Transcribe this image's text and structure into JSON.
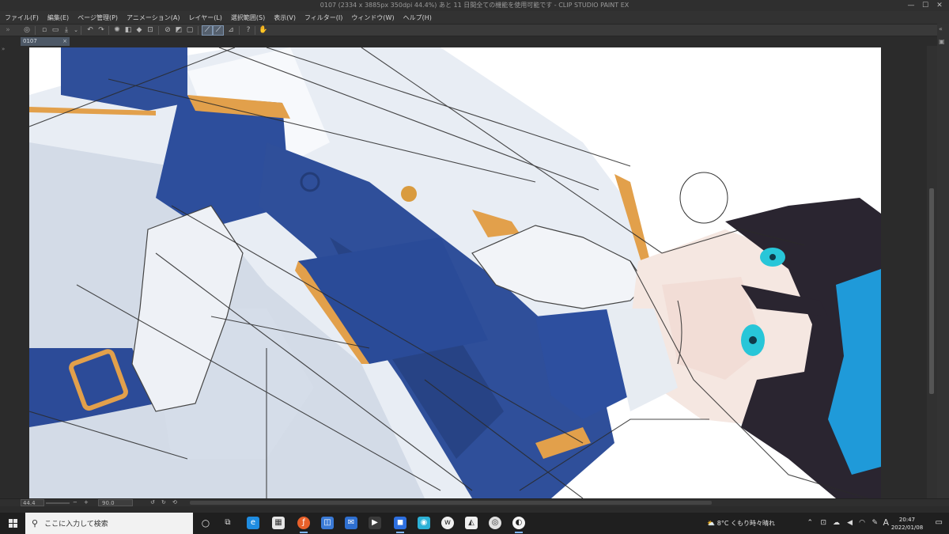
{
  "window": {
    "title": "0107 (2334 x 3885px 350dpi 44.4%)  あと 11 日間全ての機能を使用可能です - CLIP STUDIO PAINT EX",
    "minimize": "—",
    "maximize": "☐",
    "close": "✕"
  },
  "menu": [
    "ファイル(F)",
    "編集(E)",
    "ページ管理(P)",
    "アニメーション(A)",
    "レイヤー(L)",
    "選択範囲(S)",
    "表示(V)",
    "フィルター(I)",
    "ウィンドウ(W)",
    "ヘルプ(H)"
  ],
  "toolbar": {
    "icons": [
      "clip-studio-icon",
      "new-icon",
      "open-icon",
      "save-icon",
      "undo-icon",
      "redo-icon",
      "clear-icon",
      "fill-icon",
      "transform-icon",
      "deselect-icon",
      "invert-selection-icon",
      "selection-border-icon",
      "snap-ruler-icon",
      "snap-grid-icon",
      "ruler-icon",
      "help-icon",
      "hand-icon"
    ]
  },
  "document_tab": {
    "label": "0107",
    "close": "×"
  },
  "statusbar": {
    "zoom": "44.4",
    "zoom_minus": "−",
    "zoom_plus": "+",
    "rotation": "90.0"
  },
  "taskbar": {
    "search_placeholder": "ここに入力して検索",
    "weather": "8°C  くもり時々晴れ",
    "ime": "A",
    "time": "20:47",
    "date": "2022/01/08"
  },
  "colors": {
    "uniform_blue": "#2f4f9a",
    "uniform_blue_dark": "#233c78",
    "gold": "#e2a04b",
    "hair": "#2a2530",
    "hair_highlight": "#1f9ad9",
    "eye": "#28c6d8",
    "skin": "#f3e3dc",
    "white_cloth": "#e9edf3",
    "shadow": "#c9d3e2"
  }
}
